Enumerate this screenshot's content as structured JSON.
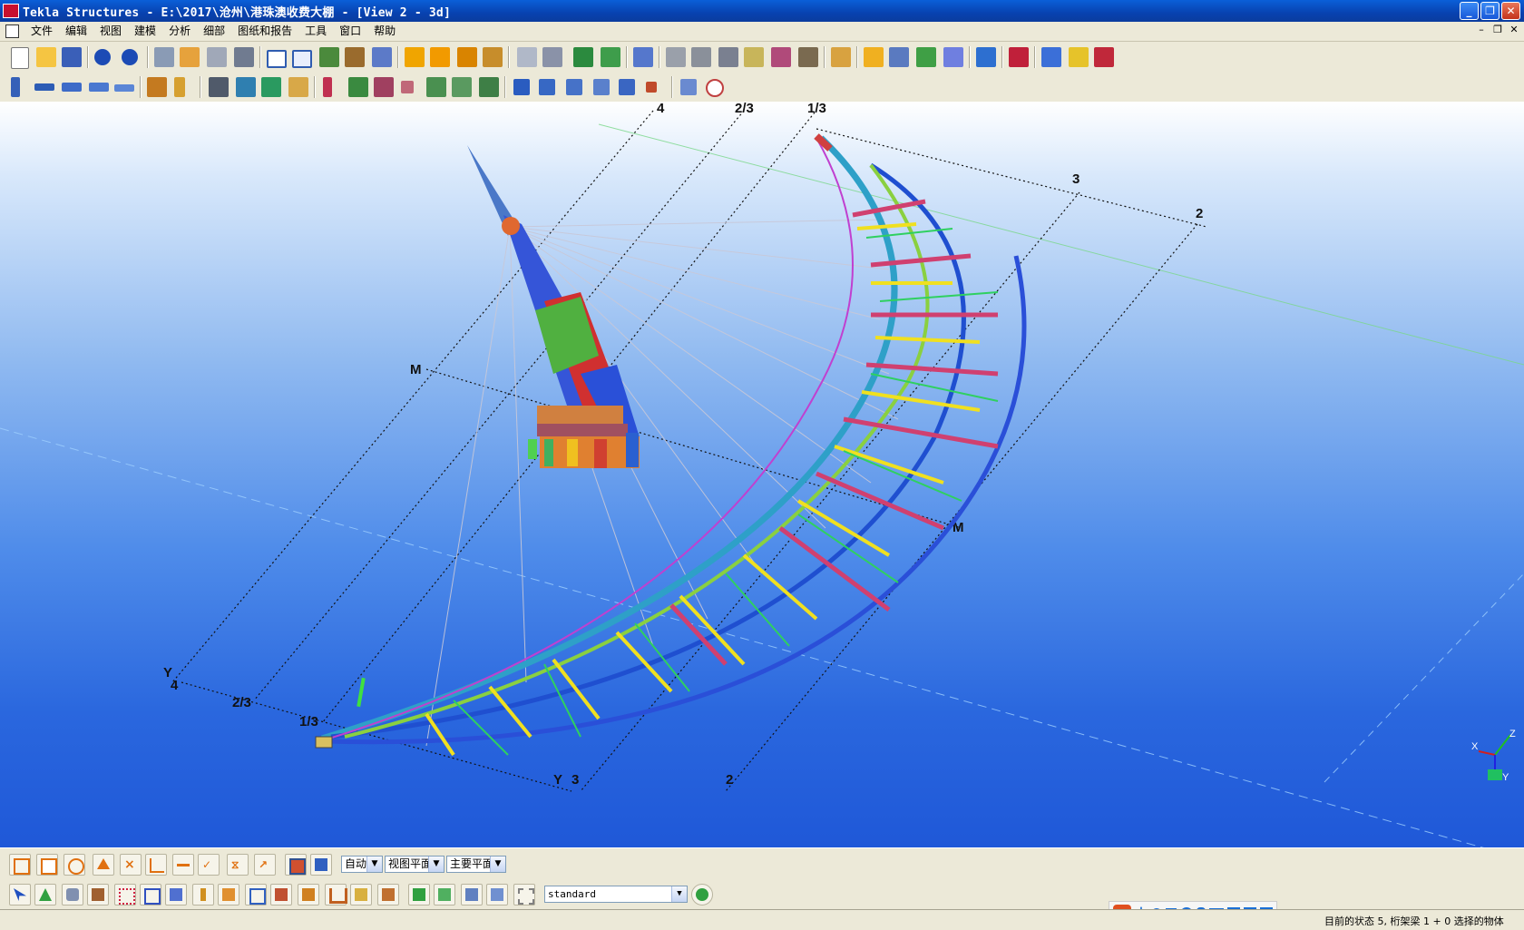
{
  "window": {
    "title": "Tekla Structures  - E:\\2017\\沧州\\港珠澳收费大棚  - [View 2 - 3d]",
    "controls": [
      "_",
      "❐",
      "✕"
    ]
  },
  "menu": {
    "items": [
      "文件",
      "编辑",
      "视图",
      "建模",
      "分析",
      "细部",
      "图纸和报告",
      "工具",
      "窗口",
      "帮助"
    ],
    "mdi_controls": [
      "–",
      "❐",
      "✕"
    ]
  },
  "viewport": {
    "grid_labels": {
      "top": [
        "4",
        "2/3",
        "1/3"
      ],
      "right": [
        "3",
        "2"
      ],
      "row_m": "M",
      "row_m_right": "M",
      "left_y": "Y",
      "left": [
        "4",
        "2/3",
        "1/3"
      ],
      "bottom_y": "Y",
      "bottom": [
        "3",
        "2"
      ]
    },
    "axis": {
      "x": "X",
      "y": "Y",
      "z": "Z"
    }
  },
  "bottom_toolbar": {
    "snap_mode": "自动",
    "plane": "视图平面",
    "main_plane": "主要平面",
    "phase_filter": "standard"
  },
  "status": {
    "text": "目前的状态 5, 桁架梁  1 + 0 选择的物体"
  },
  "ime": {
    "label": "中"
  }
}
